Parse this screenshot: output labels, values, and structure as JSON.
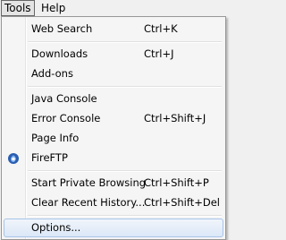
{
  "menubar": {
    "tools": "Tools",
    "help": "Help"
  },
  "menu": {
    "items": [
      {
        "label": "Web Search",
        "shortcut": "Ctrl+K"
      },
      {
        "label": "Downloads",
        "shortcut": "Ctrl+J"
      },
      {
        "label": "Add-ons",
        "shortcut": ""
      },
      {
        "label": "Java Console",
        "shortcut": ""
      },
      {
        "label": "Error Console",
        "shortcut": "Ctrl+Shift+J"
      },
      {
        "label": "Page Info",
        "shortcut": ""
      },
      {
        "label": "FireFTP",
        "shortcut": "",
        "icon": "fireftp-icon"
      },
      {
        "label": "Start Private Browsing",
        "shortcut": "Ctrl+Shift+P"
      },
      {
        "label": "Clear Recent History...",
        "shortcut": "Ctrl+Shift+Del"
      },
      {
        "label": "Options...",
        "shortcut": ""
      }
    ]
  },
  "colors": {
    "highlight_border": "#a8c4e8",
    "highlight_fill": "#dbe7f7",
    "menu_bg": "#f5f5f5",
    "fireftp_icon": "#2a5db0"
  }
}
